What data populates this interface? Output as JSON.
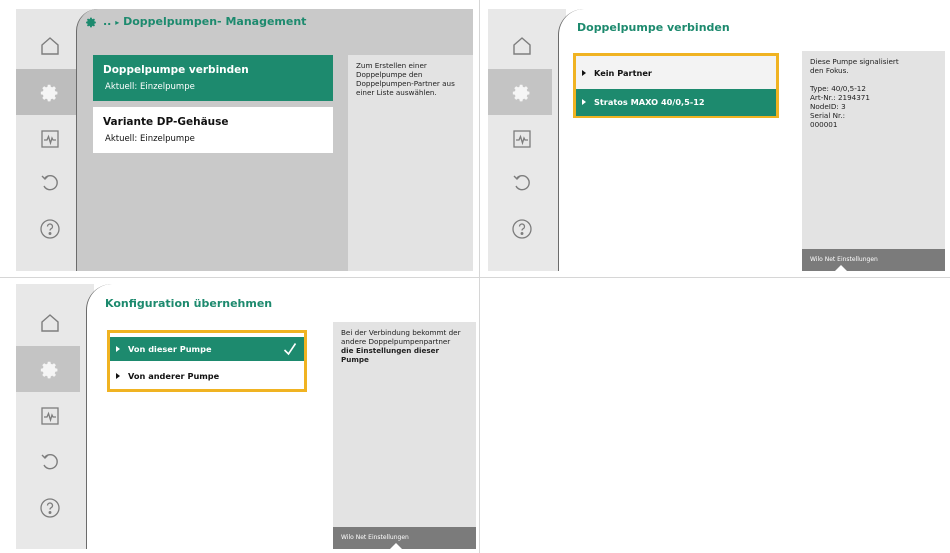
{
  "colors": {
    "accent": "#1d8a6e",
    "focus_border": "#f0b322",
    "info_background": "#e3e3e3",
    "footer_background": "#7b7b7b"
  },
  "sidebar_icons": [
    "home-icon",
    "settings-gear-icon",
    "diagnostics-pulse-icon",
    "undo-icon",
    "help-icon"
  ],
  "screen1": {
    "breadcrumb": "..",
    "title": "Doppelpumpen- Management",
    "items": [
      {
        "title": "Doppelpumpe verbinden",
        "subtitle": "Aktuell: Einzelpumpe",
        "selected": true
      },
      {
        "title": "Variante DP-Gehäuse",
        "subtitle": "Aktuell: Einzelpumpe",
        "selected": false
      }
    ],
    "info_text": "Zum Erstellen einer Doppelpumpe den Doppelpumpen-Partner aus einer Liste auswählen."
  },
  "screen2": {
    "title": "Doppelpumpe verbinden",
    "items": [
      {
        "label": "Kein Partner",
        "selected": false
      },
      {
        "label": "Stratos MAXO 40/0,5-12",
        "selected": true
      }
    ],
    "info_lines": [
      "Diese Pumpe signalisiert",
      "den Fokus.",
      "",
      "Type: 40/0,5-12",
      "Art-Nr.: 2194371",
      "NodeID: 3",
      "Serial Nr.:",
      "000001"
    ],
    "footer": "Wilo Net Einstellungen"
  },
  "screen3": {
    "title": "Konfiguration übernehmen",
    "items": [
      {
        "label": "Von dieser Pumpe",
        "selected": true,
        "checked": true
      },
      {
        "label": "Von anderer Pumpe",
        "selected": false,
        "checked": false
      }
    ],
    "info_text": "Bei der Verbindung bekommt der andere Doppelpumpenpartner",
    "info_bold": "die Einstellungen dieser Pumpe",
    "footer": "Wilo Net Einstellungen"
  }
}
